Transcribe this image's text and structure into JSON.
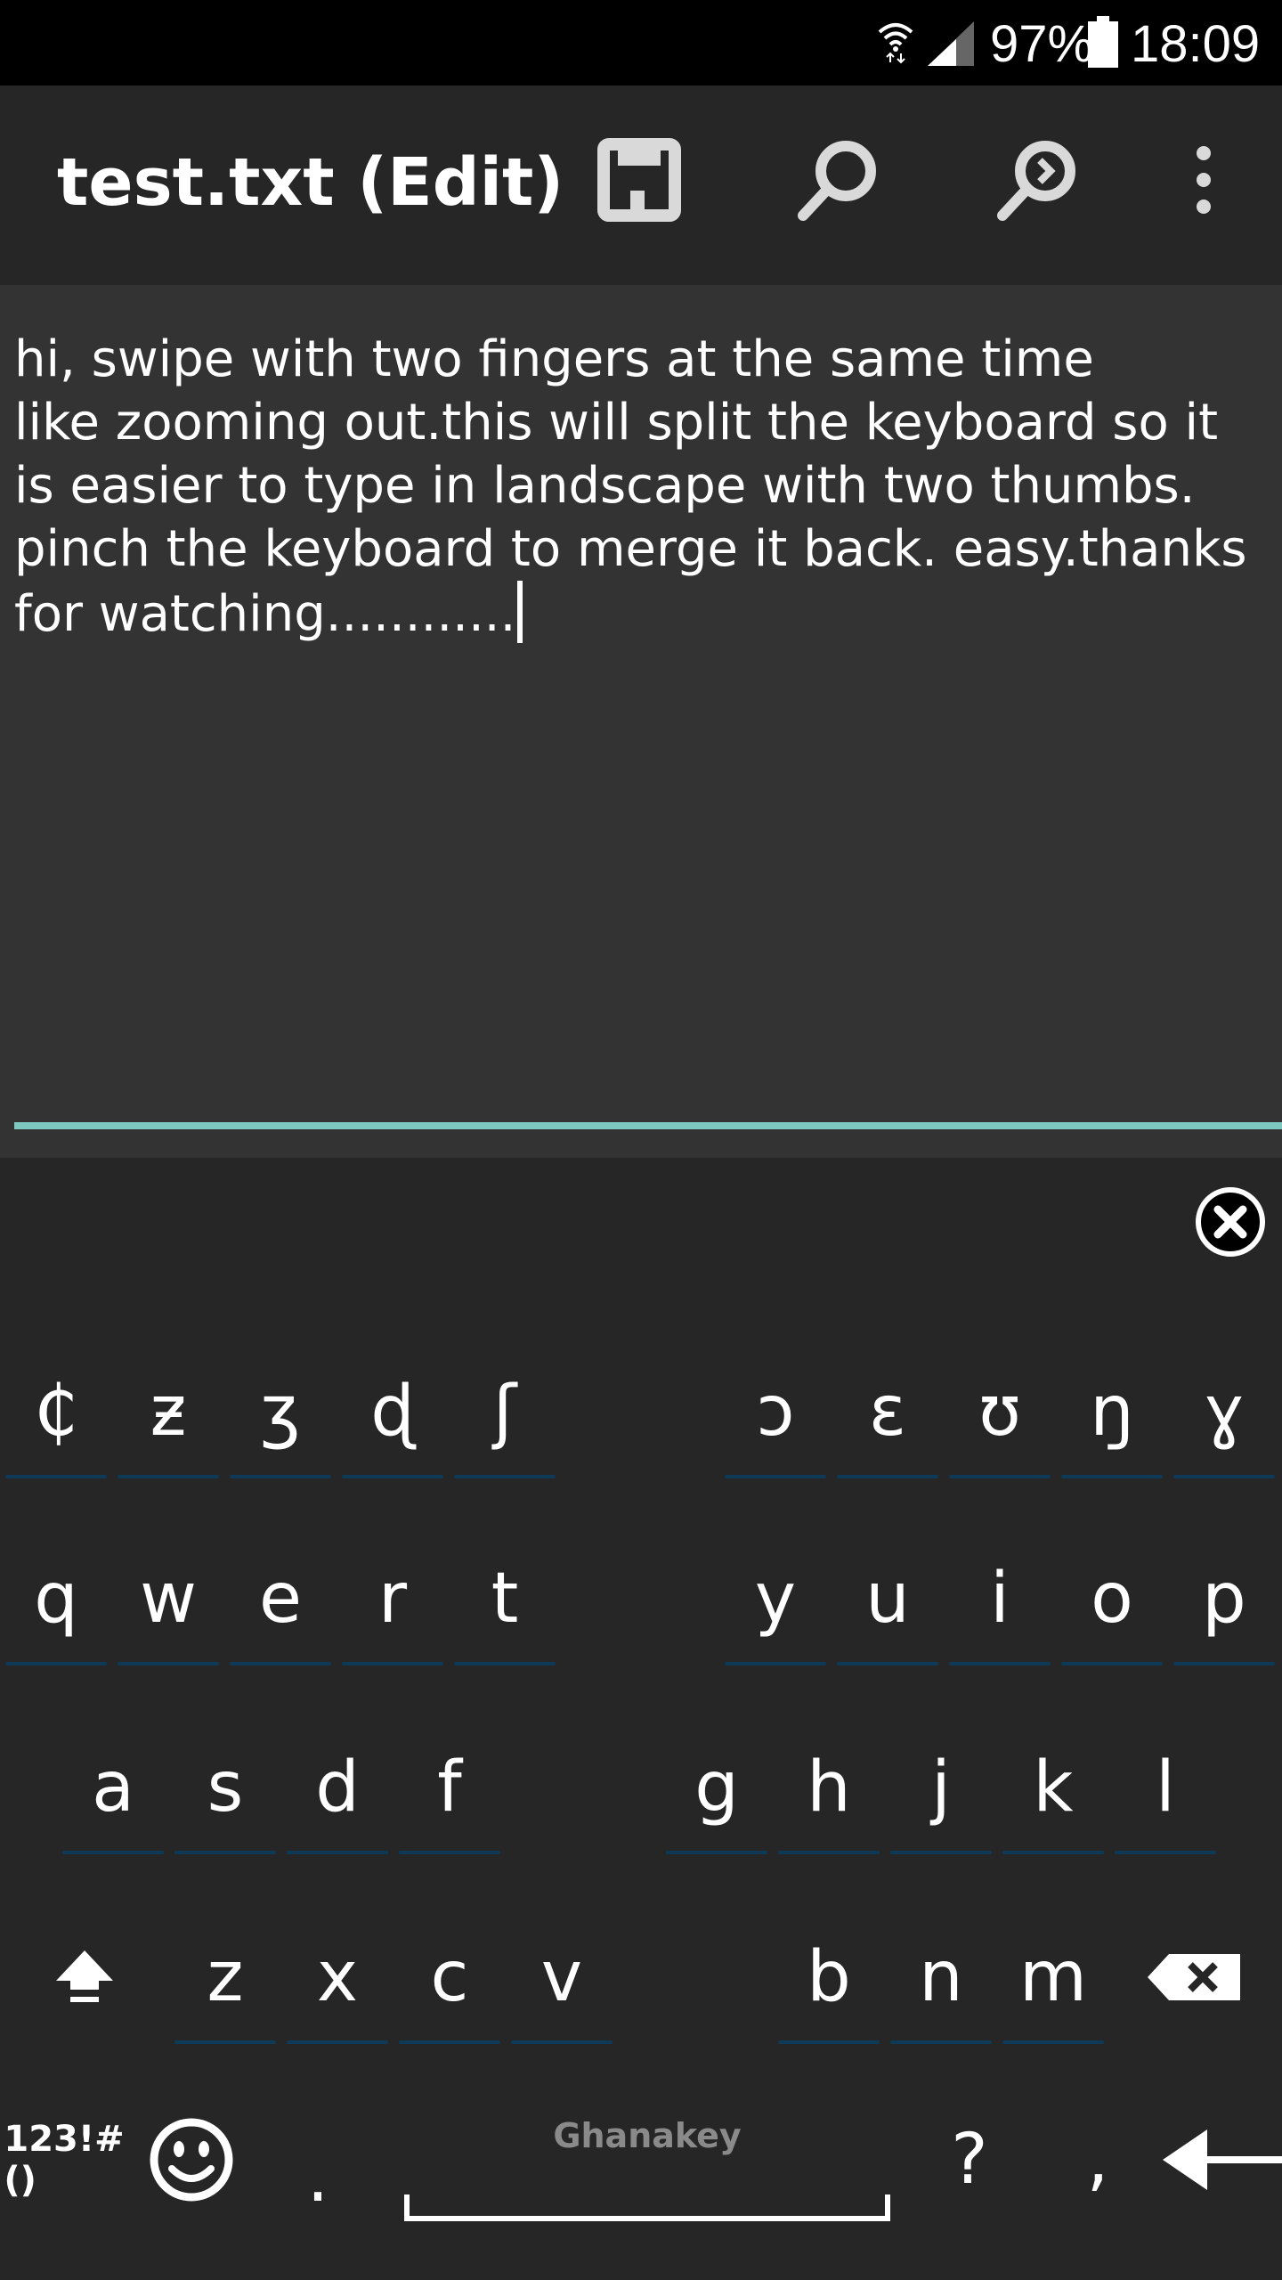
{
  "status_bar": {
    "battery_percent": "97%",
    "time": "18:09",
    "icons": [
      "wifi-icon",
      "signal-icon",
      "battery-icon"
    ]
  },
  "app_bar": {
    "title": "test.txt (Edit)",
    "actions": [
      "save-icon",
      "search-icon",
      "search-next-icon",
      "overflow-menu-icon"
    ]
  },
  "editor": {
    "text": "hi, swipe with two fingers at the same time\nlike zooming out.this will split the keyboard so it\nis easier to type in landscape with two thumbs.\npinch the keyboard to merge it back. easy.thanks\nfor watching............",
    "underline_color": "#7fc8c0"
  },
  "keyboard": {
    "close_icon": "close-circle-icon",
    "row_special": {
      "left": [
        "₵",
        "ƶ",
        "ʒ",
        "ɖ",
        "ʃ"
      ],
      "right": [
        "ɔ",
        "ɛ",
        "ʊ",
        "ŋ",
        "ɣ"
      ]
    },
    "row1": {
      "left": [
        "q",
        "w",
        "e",
        "r",
        "t"
      ],
      "right": [
        "y",
        "u",
        "i",
        "o",
        "p"
      ]
    },
    "row2": {
      "left": [
        "a",
        "s",
        "d",
        "f"
      ],
      "right": [
        "g",
        "h",
        "j",
        "k",
        "l"
      ]
    },
    "row3": {
      "left": [
        "z",
        "x",
        "c",
        "v"
      ],
      "right": [
        "b",
        "n",
        "m"
      ]
    },
    "bottom": {
      "symbols_label": "123!#()",
      "period": ".",
      "brand": "Ghanakey",
      "question": "?",
      "comma": ","
    },
    "key_underline_color": "#0e3a57"
  }
}
